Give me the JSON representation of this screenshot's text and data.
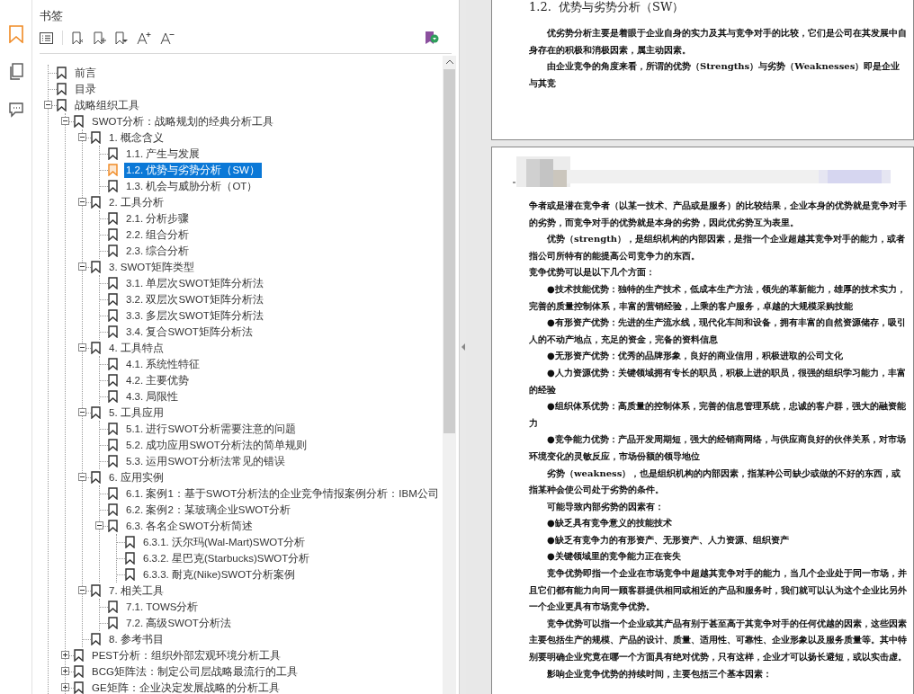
{
  "side_tabs": [
    {
      "kind": "bookmarks",
      "selected": true
    },
    {
      "kind": "pages",
      "selected": false
    },
    {
      "kind": "comments",
      "selected": false
    }
  ],
  "bookmarks_panel": {
    "title": "书签"
  },
  "bookmarks": [
    {
      "label": "前言",
      "selected": false
    },
    {
      "label": "目录",
      "selected": false
    },
    {
      "label": "战略组织工具",
      "selected": false,
      "expanded": true,
      "children": [
        {
          "label": "SWOT分析：战略规划的经典分析工具",
          "selected": false,
          "expanded": true,
          "children": [
            {
              "label": "1. 概念含义",
              "selected": false,
              "expanded": true,
              "children": [
                {
                  "label": "1.1. 产生与发展",
                  "selected": false
                },
                {
                  "label": "1.2. 优势与劣势分析（SW）",
                  "selected": true
                },
                {
                  "label": "1.3. 机会与威胁分析（OT）",
                  "selected": false
                }
              ]
            },
            {
              "label": "2. 工具分析",
              "selected": false,
              "expanded": true,
              "children": [
                {
                  "label": "2.1. 分析步骤",
                  "selected": false
                },
                {
                  "label": "2.2. 组合分析",
                  "selected": false
                },
                {
                  "label": "2.3. 综合分析",
                  "selected": false
                }
              ]
            },
            {
              "label": "3. SWOT矩阵类型",
              "selected": false,
              "expanded": true,
              "children": [
                {
                  "label": "3.1. 单层次SWOT矩阵分析法",
                  "selected": false
                },
                {
                  "label": "3.2. 双层次SWOT矩阵分析法",
                  "selected": false
                },
                {
                  "label": "3.3. 多层次SWOT矩阵分析法",
                  "selected": false
                },
                {
                  "label": "3.4. 复合SWOT矩阵分析法",
                  "selected": false
                }
              ]
            },
            {
              "label": "4. 工具特点",
              "selected": false,
              "expanded": true,
              "children": [
                {
                  "label": "4.1. 系统性特征",
                  "selected": false
                },
                {
                  "label": "4.2. 主要优势",
                  "selected": false
                },
                {
                  "label": "4.3. 局限性",
                  "selected": false
                }
              ]
            },
            {
              "label": "5. 工具应用",
              "selected": false,
              "expanded": true,
              "children": [
                {
                  "label": "5.1. 进行SWOT分析需要注意的问题",
                  "selected": false
                },
                {
                  "label": "5.2. 成功应用SWOT分析法的简单规则",
                  "selected": false
                },
                {
                  "label": "5.3. 运用SWOT分析法常见的错误",
                  "selected": false
                }
              ]
            },
            {
              "label": "6. 应用实例",
              "selected": false,
              "expanded": true,
              "children": [
                {
                  "label": "6.1. 案例1：基于SWOT分析法的企业竞争情报案例分析：IBM公司",
                  "selected": false
                },
                {
                  "label": "6.2. 案例2：某玻璃企业SWOT分析",
                  "selected": false
                },
                {
                  "label": "6.3. 各名企SWOT分析简述",
                  "selected": false,
                  "expanded": true,
                  "children": [
                    {
                      "label": "6.3.1. 沃尔玛(Wal-Mart)SWOT分析",
                      "selected": false
                    },
                    {
                      "label": "6.3.2. 星巴克(Starbucks)SWOT分析",
                      "selected": false
                    },
                    {
                      "label": "6.3.3. 耐克(Nike)SWOT分析案例",
                      "selected": false
                    }
                  ]
                }
              ]
            },
            {
              "label": "7. 相关工具",
              "selected": false,
              "expanded": true,
              "children": [
                {
                  "label": "7.1. TOWS分析",
                  "selected": false
                },
                {
                  "label": "7.2. 高级SWOT分析法",
                  "selected": false
                }
              ]
            },
            {
              "label": "8. 参考书目",
              "selected": false
            }
          ]
        },
        {
          "label": "PEST分析：组织外部宏观环境分析工具",
          "selected": false,
          "expanded": false
        },
        {
          "label": "BCG矩阵法：制定公司层战略最流行的工具",
          "selected": false,
          "expanded": false
        },
        {
          "label": "GE矩阵：企业决定发展战略的分析工具",
          "selected": false,
          "expanded": false
        }
      ]
    }
  ],
  "document": {
    "pages": [
      {
        "heading": "1.2.  优势与劣势分析（SW）",
        "paragraphs": [
          {
            "text": "优劣势分析主要是着眼于企业自身的实力及其与竞争对手的比较，它们是公司在其发展中自身存在的积极和消极因素，属主动因素。",
            "indent": true
          },
          {
            "text": "由企业竞争的角度来看，所谓的优势（Strengths）与劣势（Weaknesses）即是企业与其竞",
            "indent": true
          }
        ]
      },
      {
        "paragraphs": [
          {
            "text": "争者或是潜在竞争者（以某一技术、产品或是服务）的比较结果，企业本身的优势就是竞争对手的劣势，而竞争对手的优势就是本身的劣势，因此优劣势互为表里。",
            "indent": false
          },
          {
            "text": "优势（strength），是组织机构的内部因素，是指一个企业超越其竞争对手的能力，或者指公司所特有的能提高公司竞争力的东西。",
            "indent": true
          },
          {
            "text": "竞争优势可以是以下几个方面：",
            "indent": false
          },
          {
            "text": "●技术技能优势：独特的生产技术，低成本生产方法，领先的革新能力，雄厚的技术实力，完善的质量控制体系，丰富的营销经验，上乘的客户服务，卓越的大规模采购技能",
            "indent": true
          },
          {
            "text": "●有形资产优势：先进的生产流水线，现代化车间和设备，拥有丰富的自然资源储存，吸引人的不动产地点，充足的资金，完备的资料信息",
            "indent": true
          },
          {
            "text": "●无形资产优势：优秀的品牌形象，良好的商业信用，积极进取的公司文化",
            "indent": true
          },
          {
            "text": "●人力资源优势：关键领域拥有专长的职员，积极上进的职员，很强的组织学习能力，丰富的经验",
            "indent": true
          },
          {
            "text": "●组织体系优势：高质量的控制体系，完善的信息管理系统，忠诚的客户群，强大的融资能力",
            "indent": true
          },
          {
            "text": "●竞争能力优势：产品开发周期短，强大的经销商网络，与供应商良好的伙伴关系，对市场环境变化的灵敏反应，市场份额的领导地位",
            "indent": true
          },
          {
            "text": "劣势（weakness），也是组织机构的内部因素，指某种公司缺少或做的不好的东西，或指某种会使公司处于劣势的条件。",
            "indent": true
          },
          {
            "text": "可能导致内部劣势的因素有：",
            "indent": true
          },
          {
            "text": "●缺乏具有竞争意义的技能技术",
            "indent": true
          },
          {
            "text": "●缺乏有竞争力的有形资产、无形资产、人力资源、组织资产",
            "indent": true
          },
          {
            "text": "●关键领域里的竞争能力正在丧失",
            "indent": true
          },
          {
            "text": "竞争优势即指一个企业在市场竞争中超越其竞争对手的能力，当几个企业处于同一市场，并且它们都有能力向同一顾客群提供相同或相近的产品和服务时，我们就可以认为这个企业比另外一个企业更具有市场竞争优势。",
            "indent": true
          },
          {
            "text": "竞争优势可以指一个企业或其产品有别于甚至高于其竞争对手的任何优越的因素，这些因素主要包括生产的规模、产品的设计、质量、适用性、可靠性、企业形象以及服务质量等。其中特别要明确企业究竟在哪一个方面具有绝对优势，只有这样，企业才可以扬长避短，或以实击虚。",
            "indent": true
          },
          {
            "text": "影响企业竞争优势的持续时间，主要包括三个基本因素：",
            "indent": true
          }
        ]
      }
    ]
  }
}
